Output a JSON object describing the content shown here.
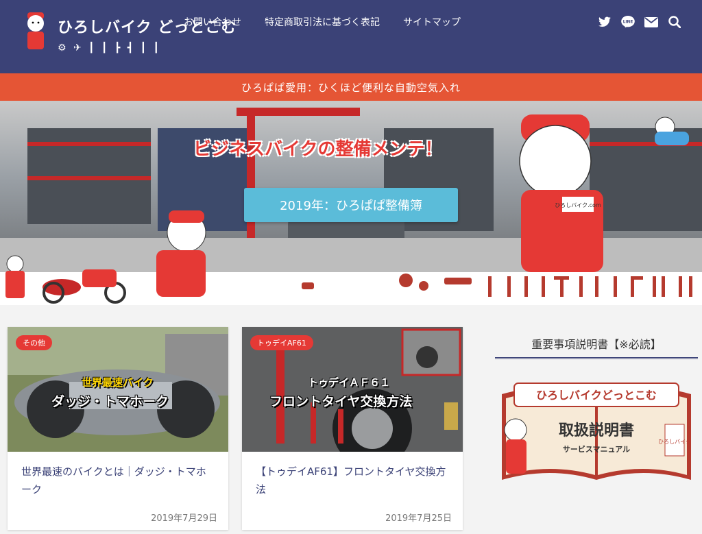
{
  "header": {
    "logo_text": "ひろしバイク どっとこむ",
    "logo_sub": "⚙ ✈ ┃ ┃ ┣ ┫ ┃ ┃",
    "nav": [
      {
        "label": "お問い合わせ"
      },
      {
        "label": "特定商取引法に基づく表記"
      },
      {
        "label": "サイトマップ"
      }
    ],
    "social": [
      {
        "icon": "twitter-icon"
      },
      {
        "icon": "line-icon"
      },
      {
        "icon": "mail-icon"
      },
      {
        "icon": "search-icon"
      }
    ],
    "bg_color": "#3b4277"
  },
  "notice": {
    "text": "ひろぱぱ愛用：ひくほど便利な自動空気入れ",
    "bg_color": "#e55535"
  },
  "hero": {
    "title": "ビジネスバイクの整備メンテ！",
    "button_label": "2019年：ひろぱぱ整備簿",
    "character_tag": "ひろしバイク.com"
  },
  "cards": [
    {
      "category": "その他",
      "overlay_line1": "世界最速バイク",
      "overlay_line2": "ダッジ・トマホーク",
      "title": "世界最速のバイクとは｜ダッジ・トマホーク",
      "date": "2019年7月29日"
    },
    {
      "category": "トゥデイAF61",
      "overlay_line1": "トゥデイＡＦ６１",
      "overlay_line2": "フロントタイヤ交換方法",
      "title": "【トゥデイAF61】フロントタイヤ交換方法",
      "date": "2019年7月25日"
    }
  ],
  "sidebar": {
    "widget_title": "重要事項説明書【※必読】",
    "manual_line1": "ひろしバイクどっとこむ",
    "manual_line2": "取扱説明書",
    "manual_line3": "サービスマニュアル",
    "manual_side": "ひろしバイク"
  },
  "colors": {
    "accent": "#e53935",
    "button": "#5bbcd9",
    "link": "#3b4277"
  }
}
